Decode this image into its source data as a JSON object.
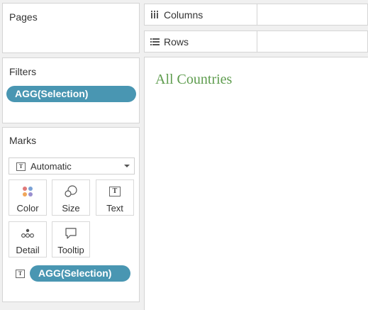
{
  "pages": {
    "title": "Pages"
  },
  "filters": {
    "title": "Filters",
    "pill": "AGG(Selection)"
  },
  "marks": {
    "title": "Marks",
    "mark_type": "Automatic",
    "buttons": {
      "color": "Color",
      "size": "Size",
      "text": "Text",
      "detail": "Detail",
      "tooltip": "Tooltip"
    },
    "pill": "AGG(Selection)"
  },
  "shelves": {
    "columns": "Columns",
    "rows": "Rows"
  },
  "view": {
    "title": "All Countries"
  },
  "colors": {
    "pill": "#4996b2",
    "title": "#5e9c4e"
  },
  "icons": [
    "columns-icon",
    "rows-icon",
    "text-icon",
    "color-icon",
    "size-icon",
    "detail-icon",
    "tooltip-icon",
    "dropdown-caret-icon"
  ]
}
